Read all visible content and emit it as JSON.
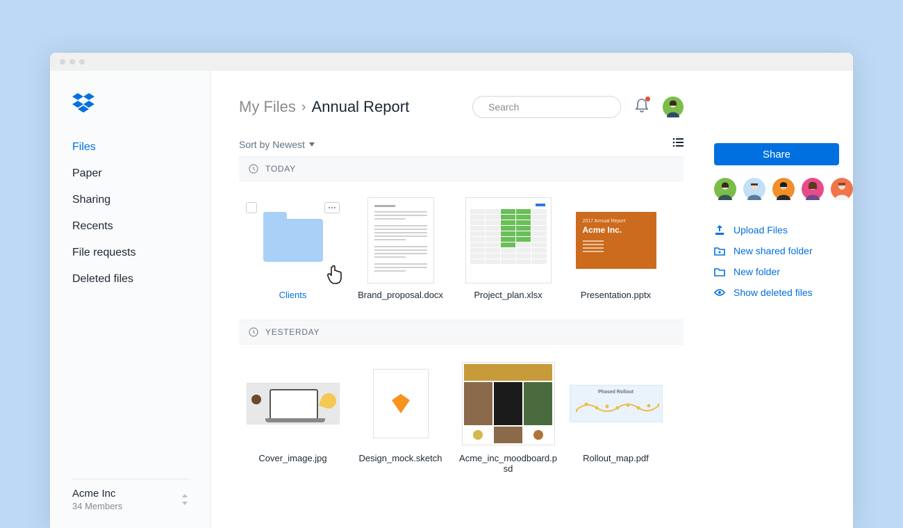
{
  "sidebar": {
    "items": [
      {
        "label": "Files",
        "active": true
      },
      {
        "label": "Paper"
      },
      {
        "label": "Sharing"
      },
      {
        "label": "Recents"
      },
      {
        "label": "File requests"
      },
      {
        "label": "Deleted files"
      }
    ],
    "org_name": "Acme Inc",
    "org_members": "34 Members"
  },
  "breadcrumb": {
    "root": "My Files",
    "current": "Annual Report"
  },
  "search": {
    "placeholder": "Search"
  },
  "sort_label": "Sort by Newest",
  "groups": [
    {
      "label": "TODAY",
      "items": [
        {
          "name": "Clients",
          "type": "folder",
          "active": true
        },
        {
          "name": "Brand_proposal.docx",
          "type": "doc"
        },
        {
          "name": "Project_plan.xlsx",
          "type": "sheet"
        },
        {
          "name": "Presentation.pptx",
          "type": "ppt",
          "ppt_sub": "2017 Annual Report",
          "ppt_title": "Acme Inc."
        }
      ]
    },
    {
      "label": "YESTERDAY",
      "items": [
        {
          "name": "Cover_image.jpg",
          "type": "image"
        },
        {
          "name": "Design_mock.sketch",
          "type": "sketch"
        },
        {
          "name": "Acme_inc_moodboard.psd",
          "type": "mood"
        },
        {
          "name": "Rollout_map.pdf",
          "type": "rollout",
          "rollout_title": "Phased Rollout"
        }
      ]
    }
  ],
  "share_label": "Share",
  "member_colors": [
    "#7bbd4a",
    "#7fb3e6",
    "#f18f2b",
    "#e84b8a",
    "#f0764a"
  ],
  "actions": [
    {
      "label": "Upload Files",
      "icon": "upload-icon"
    },
    {
      "label": "New shared folder",
      "icon": "shared-folder-icon"
    },
    {
      "label": "New folder",
      "icon": "new-folder-icon"
    },
    {
      "label": "Show deleted files",
      "icon": "eye-icon"
    }
  ],
  "notification_dot": true
}
